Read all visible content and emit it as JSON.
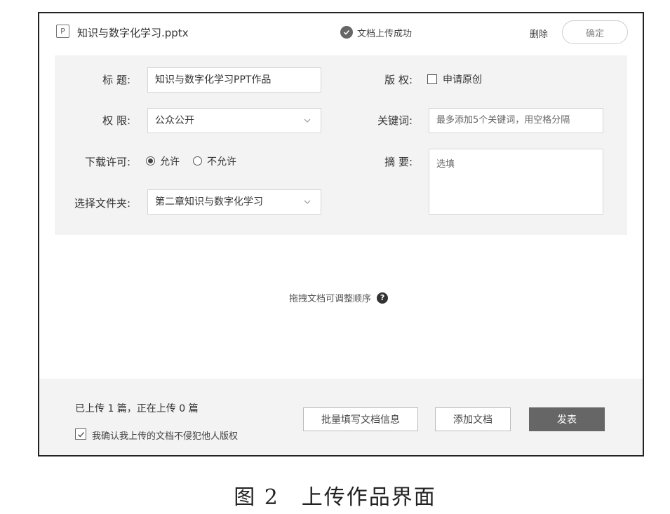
{
  "header": {
    "file_type_icon": "P",
    "file_name": "知识与数字化学习.pptx",
    "status_text": "文档上传成功",
    "delete_label": "删除",
    "confirm_label": "确定"
  },
  "form": {
    "title_label": "标 题:",
    "title_value": "知识与数字化学习PPT作品",
    "permission_label": "权 限:",
    "permission_value": "公众公开",
    "download_label": "下载许可:",
    "download_options": [
      "允许",
      "不允许"
    ],
    "download_selected": "允许",
    "folder_label": "选择文件夹:",
    "folder_value": "第二章知识与数字化学习",
    "copyright_label": "版 权:",
    "copyright_option": "申请原创",
    "keywords_label": "关键词:",
    "keywords_placeholder": "最多添加5个关键词，用空格分隔",
    "summary_label": "摘 要:",
    "summary_placeholder": "选填"
  },
  "hint": {
    "text": "拖拽文档可调整顺序",
    "icon": "help-icon"
  },
  "footer": {
    "upload_count": "已上传 1 篇，正在上传 0 篇",
    "agree_text": "我确认我上传的文档不侵犯他人版权",
    "batch_button": "批量填写文档信息",
    "add_button": "添加文档",
    "publish_button": "发表"
  },
  "caption": "图 2　上传作品界面",
  "colors": {
    "panel_bg": "#f3f3f3",
    "primary_button": "#666666",
    "border": "#d6d6d6"
  }
}
